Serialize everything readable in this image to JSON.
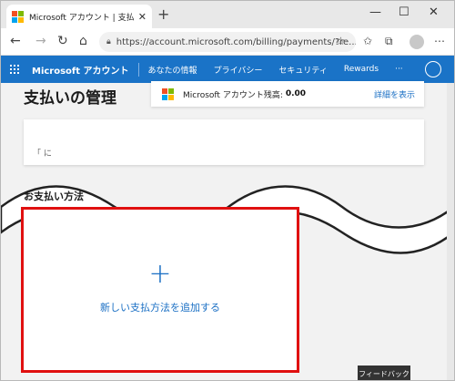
{
  "browser": {
    "tab_title": "Microsoft アカウント | 支払いオプション",
    "url": "https://account.microsoft.com/billing/payments/?re...",
    "new_tab_glyph": "+",
    "tab_close_glyph": "✕",
    "win_minimize": "—",
    "win_maximize": "☐",
    "win_close": "✕"
  },
  "ms_nav": {
    "brand": "Microsoft アカウント",
    "items": [
      "あなたの情報",
      "プライバシー",
      "セキュリティ",
      "Rewards",
      "···"
    ]
  },
  "page": {
    "title": "支払いの管理",
    "balance_label": "Microsoft アカウント残高:",
    "balance_value": "0.00",
    "details_link": "詳細を表示",
    "card2_partial_text": "「                              に",
    "section_title": "お支払い方法",
    "add_plus": "+",
    "add_label": "新しい支払方法を追加する",
    "feedback": "フィードバック"
  },
  "colors": {
    "nav_blue": "#1a73c7",
    "link_blue": "#1a6fc4",
    "highlight_red": "#e01010",
    "ms_logo": [
      "#f25022",
      "#7fba00",
      "#00a4ef",
      "#ffb900"
    ]
  }
}
